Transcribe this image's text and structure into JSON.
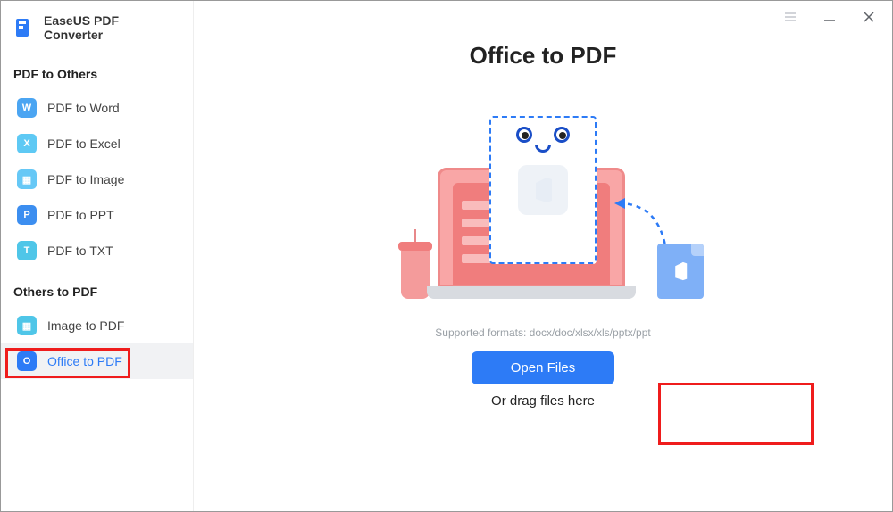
{
  "app": {
    "title": "EaseUS PDF Converter"
  },
  "sidebar": {
    "sections": [
      {
        "header": "PDF to Others",
        "items": [
          {
            "label": "PDF to Word",
            "icon": "W",
            "color": "#4ba5f2"
          },
          {
            "label": "PDF to Excel",
            "icon": "X",
            "color": "#5ec9f4"
          },
          {
            "label": "PDF to Image",
            "icon": "▦",
            "color": "#66c8f6"
          },
          {
            "label": "PDF to PPT",
            "icon": "P",
            "color": "#3c8ef0"
          },
          {
            "label": "PDF to TXT",
            "icon": "T",
            "color": "#4fc6e8"
          }
        ]
      },
      {
        "header": "Others to PDF",
        "items": [
          {
            "label": "Image to PDF",
            "icon": "▦",
            "color": "#4fc6e8"
          },
          {
            "label": "Office to PDF",
            "icon": "O",
            "color": "#2d7bf6",
            "selected": true
          }
        ]
      }
    ]
  },
  "main": {
    "title": "Office to PDF",
    "supported_text": "Supported formats: docx/doc/xlsx/xls/pptx/ppt",
    "open_button": "Open Files",
    "drag_text": "Or drag files here"
  },
  "window_controls": {
    "menu": "menu",
    "minimize": "minimize",
    "close": "close"
  }
}
